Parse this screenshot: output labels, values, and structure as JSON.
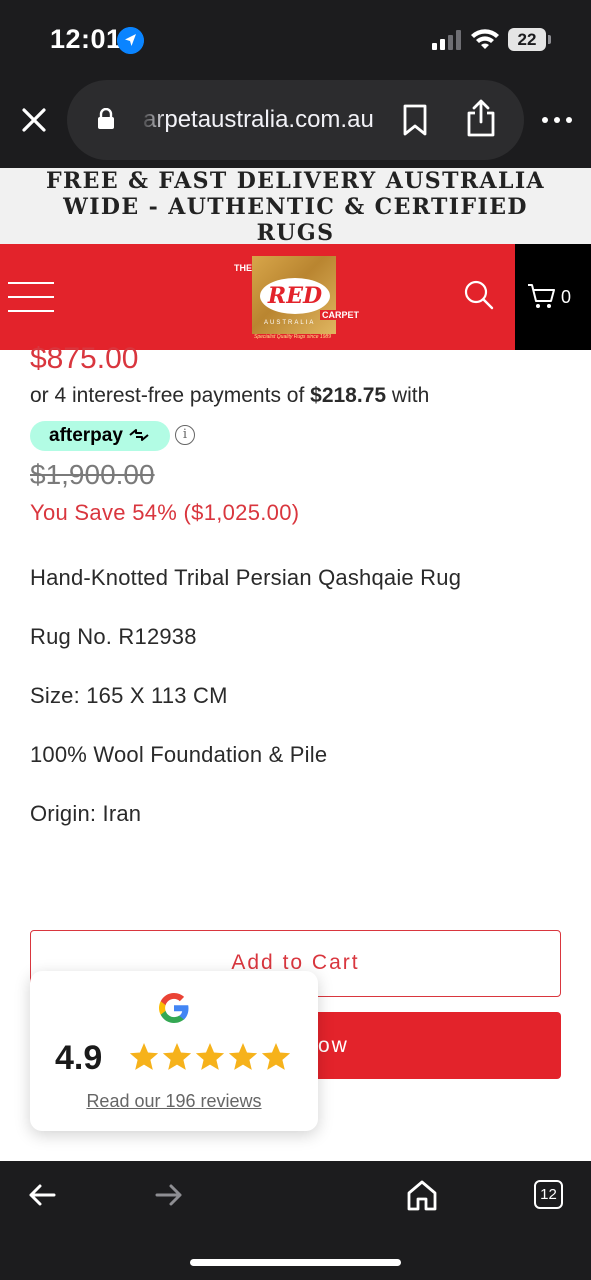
{
  "status_bar": {
    "time": "12:01",
    "battery": "22"
  },
  "browser": {
    "url": "carpetaustralia.com.au",
    "tabs_count": "12"
  },
  "promo_banner": {
    "text": "FREE & FAST DELIVERY AUSTRALIA WIDE - AUTHENTIC & CERTIFIED RUGS"
  },
  "header": {
    "logo": {
      "the": "THE",
      "red": "RED",
      "carpet": "CARPET",
      "australia": "AUSTRALIA",
      "tagline": "Specialist Quality Rugs since 1989"
    },
    "cart_count": "0"
  },
  "product": {
    "price": "$875.00",
    "installments_prefix": "or 4 interest-free payments of ",
    "installment_amount": "$218.75",
    "installments_suffix": " with",
    "afterpay_label": "afterpay",
    "compare_price": "$1,900.00",
    "savings": "You Save 54% ($1,025.00)",
    "details": [
      "Hand-Knotted Tribal Persian Qashqaie Rug",
      "Rug No. R12938",
      "Size: 165 X 113 CM",
      "100% Wool Foundation & Pile",
      "Origin: Iran"
    ],
    "add_to_cart_label": "Add to Cart",
    "buy_now_label_visible": "ow"
  },
  "reviews_widget": {
    "rating": "4.9",
    "stars": 5,
    "link_text": "Read our 196 reviews"
  },
  "colors": {
    "brand_red": "#e3232b",
    "price_red": "#d9363e",
    "afterpay_mint": "#b2fce4"
  }
}
